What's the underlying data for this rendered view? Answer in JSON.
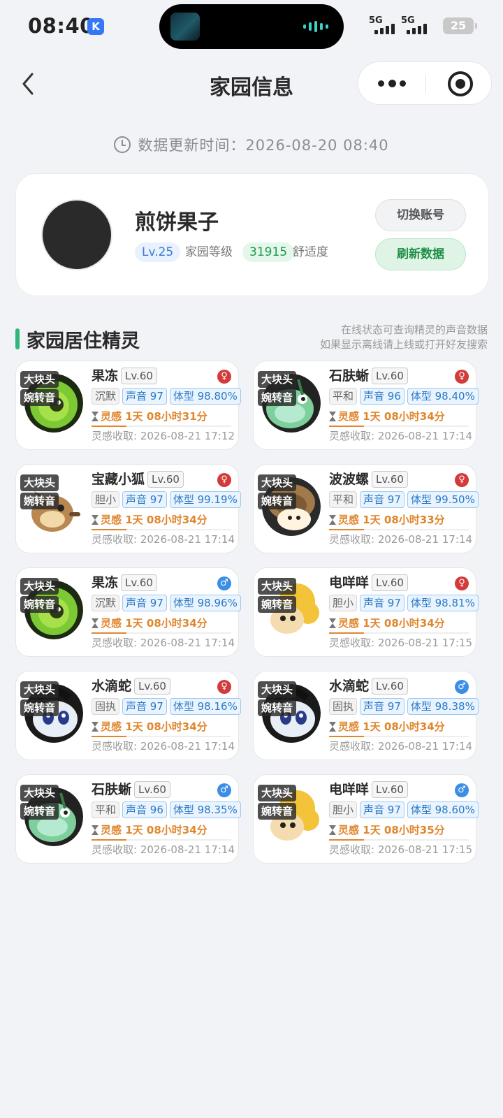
{
  "status_bar": {
    "time": "08:40",
    "k_badge": "K",
    "sig1_label": "5G",
    "sig2_label": "5G",
    "battery": "25"
  },
  "nav": {
    "title": "家园信息"
  },
  "update": {
    "prefix": "数据更新时间：",
    "time": "2026-08-20 08:40"
  },
  "profile": {
    "nickname": "煎饼果子",
    "level": "Lv.25",
    "level_label": "家园等级",
    "comfort": "31915",
    "comfort_label": "舒适度",
    "switch_label": "切换账号",
    "refresh_label": "刷新数据"
  },
  "section": {
    "title": "家园居住精灵",
    "hint_line1": "在线状态可查询精灵的声音数据",
    "hint_line2": "如果显示离线请上线或打开好友搜索"
  },
  "spirits": [
    {
      "tag1": "大块头",
      "tag2": "婉转音",
      "name": "果冻",
      "level": "Lv.60",
      "gender": "female",
      "gender_symbol": "♀",
      "nature": "沉默",
      "voice": "声音 97",
      "size": "体型 98.80%",
      "timer": "灵感 1天 08小时31分",
      "collect": "灵感收取: 2026-08-21 17:12",
      "portrait": "jelly",
      "progress": 0.25
    },
    {
      "tag1": "大块头",
      "tag2": "婉转音",
      "name": "石肤蜥",
      "level": "Lv.60",
      "gender": "female",
      "gender_symbol": "♀",
      "nature": "平和",
      "voice": "声音 96",
      "size": "体型 98.40%",
      "timer": "灵感 1天 08小时34分",
      "collect": "灵感收取: 2026-08-21 17:14",
      "portrait": "lizard",
      "progress": 0.25
    },
    {
      "tag1": "大块头",
      "tag2": "婉转音",
      "name": "宝藏小狐",
      "level": "Lv.60",
      "gender": "female",
      "gender_symbol": "♀",
      "nature": "胆小",
      "voice": "声音 97",
      "size": "体型 99.19%",
      "timer": "灵感 1天 08小时34分",
      "collect": "灵感收取: 2026-08-21 17:14",
      "portrait": "fox",
      "progress": 0.25
    },
    {
      "tag1": "大块头",
      "tag2": "婉转音",
      "name": "波波螺",
      "level": "Lv.60",
      "gender": "female",
      "gender_symbol": "♀",
      "nature": "平和",
      "voice": "声音 97",
      "size": "体型 99.50%",
      "timer": "灵感 1天 08小时33分",
      "collect": "灵感收取: 2026-08-21 17:14",
      "portrait": "snail",
      "progress": 0.25
    },
    {
      "tag1": "大块头",
      "tag2": "婉转音",
      "name": "果冻",
      "level": "Lv.60",
      "gender": "male",
      "gender_symbol": "♂",
      "nature": "沉默",
      "voice": "声音 97",
      "size": "体型 98.96%",
      "timer": "灵感 1天 08小时34分",
      "collect": "灵感收取: 2026-08-21 17:14",
      "portrait": "jelly",
      "progress": 0.25
    },
    {
      "tag1": "大块头",
      "tag2": "婉转音",
      "name": "电咩咩",
      "level": "Lv.60",
      "gender": "female",
      "gender_symbol": "♀",
      "nature": "胆小",
      "voice": "声音 97",
      "size": "体型 98.81%",
      "timer": "灵感 1天 08小时34分",
      "collect": "灵感收取: 2026-08-21 17:15",
      "portrait": "sheep",
      "progress": 0.25
    },
    {
      "tag1": "大块头",
      "tag2": "婉转音",
      "name": "水滴蛇",
      "level": "Lv.60",
      "gender": "female",
      "gender_symbol": "♀",
      "nature": "固执",
      "voice": "声音 97",
      "size": "体型 98.16%",
      "timer": "灵感 1天 08小时34分",
      "collect": "灵感收取: 2026-08-21 17:14",
      "portrait": "snake",
      "progress": 0.25
    },
    {
      "tag1": "大块头",
      "tag2": "婉转音",
      "name": "水滴蛇",
      "level": "Lv.60",
      "gender": "male",
      "gender_symbol": "♂",
      "nature": "固执",
      "voice": "声音 97",
      "size": "体型 98.38%",
      "timer": "灵感 1天 08小时34分",
      "collect": "灵感收取: 2026-08-21 17:14",
      "portrait": "snake",
      "progress": 0.25
    },
    {
      "tag1": "大块头",
      "tag2": "婉转音",
      "name": "石肤蜥",
      "level": "Lv.60",
      "gender": "male",
      "gender_symbol": "♂",
      "nature": "平和",
      "voice": "声音 96",
      "size": "体型 98.35%",
      "timer": "灵感 1天 08小时34分",
      "collect": "灵感收取: 2026-08-21 17:14",
      "portrait": "lizard",
      "progress": 0.25
    },
    {
      "tag1": "大块头",
      "tag2": "婉转音",
      "name": "电咩咩",
      "level": "Lv.60",
      "gender": "male",
      "gender_symbol": "♂",
      "nature": "胆小",
      "voice": "声音 97",
      "size": "体型 98.60%",
      "timer": "灵感 1天 08小时35分",
      "collect": "灵感收取: 2026-08-21 17:15",
      "portrait": "sheep",
      "progress": 0.25
    }
  ]
}
